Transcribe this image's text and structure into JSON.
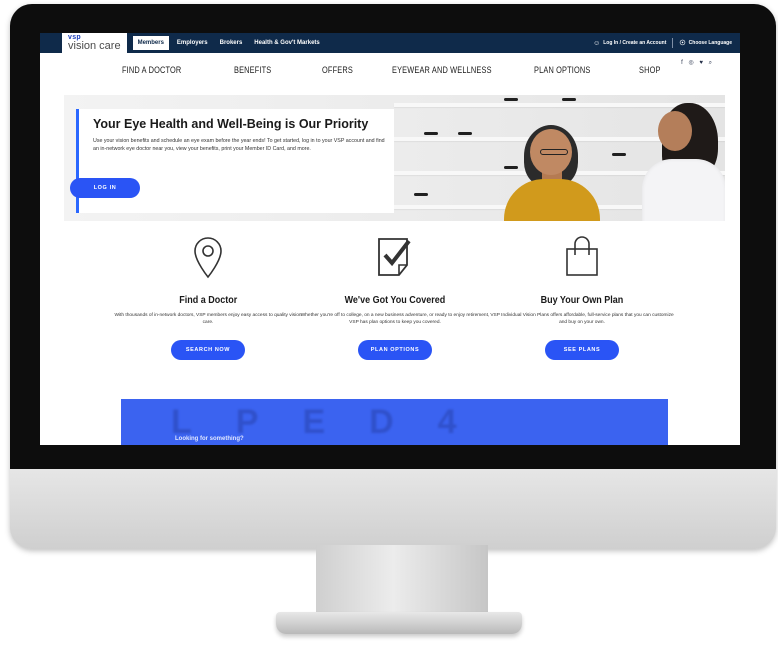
{
  "topbar": {
    "brand_top": "vsp",
    "brand_bottom": "vision care",
    "links": [
      "Members",
      "Employers",
      "Brokers",
      "Health & Gov't Markets"
    ],
    "login": "Log In / Create an Account",
    "language": "Choose Language"
  },
  "mainnav": {
    "items": [
      "FIND A DOCTOR",
      "BENEFITS",
      "OFFERS",
      "EYEWEAR AND WELLNESS",
      "PLAN OPTIONS",
      "SHOP"
    ]
  },
  "hero": {
    "title": "Your Eye Health and Well-Being is Our Priority",
    "body": "Use your vision benefits and schedule an eye exam before the year ends! To get started, log in to your VSP account and find an in-network eye doctor near you, view your benefits, print your Member ID Card, and more.",
    "button": "LOG IN"
  },
  "features": [
    {
      "title": "Find a Doctor",
      "body": "With thousands of in-network doctors, VSP members enjoy easy access to quality vision care.",
      "button": "SEARCH NOW",
      "icon": "location-pin-icon"
    },
    {
      "title": "We've Got You Covered",
      "body": "Whether you're off to college, on a new business adventure, or ready to enjoy retirement, VSP has plan options to keep you covered.",
      "button": "PLAN OPTIONS",
      "icon": "checkbox-icon"
    },
    {
      "title": "Buy Your Own Plan",
      "body": "VSP Individual Vision Plans offers affordable, full-service plans that you can customize and buy on your own.",
      "button": "SEE PLANS",
      "icon": "shopping-bag-icon"
    }
  ],
  "bluebar": {
    "text": "Looking for something?"
  },
  "colors": {
    "topbar": "#0f2a4a",
    "accent": "#2a54f5",
    "bluebar": "#3b63f0"
  }
}
